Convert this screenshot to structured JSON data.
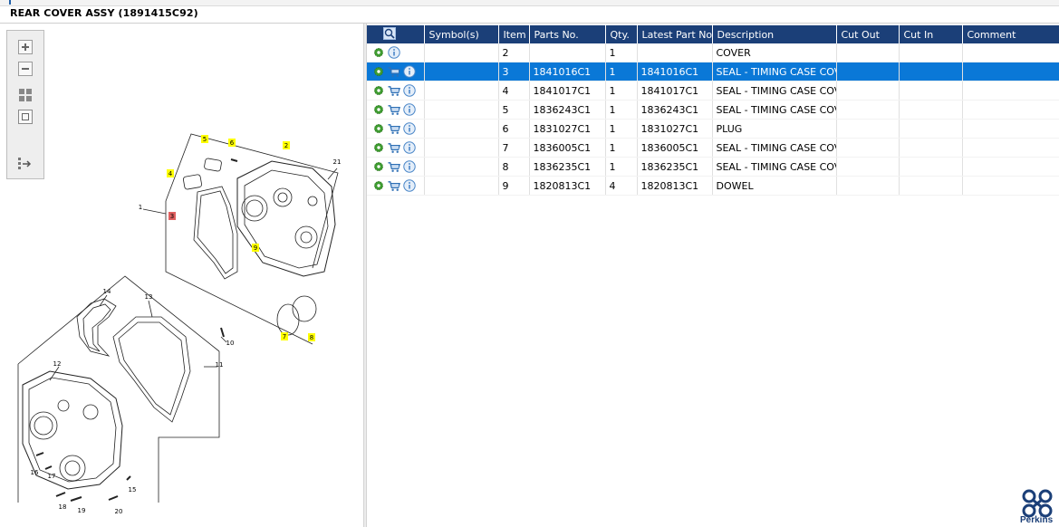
{
  "title": "REAR COVER ASSY (1891415C92)",
  "toolbar": {
    "buttons": [
      {
        "name": "zoom-in-button",
        "icon": "zoom-in-icon"
      },
      {
        "name": "zoom-out-button",
        "icon": "zoom-out-icon"
      },
      {
        "name": "fit-all-button",
        "icon": "fit-all-icon"
      },
      {
        "name": "fit-window-button",
        "icon": "fit-window-icon"
      },
      {
        "name": "export-button",
        "icon": "export-icon"
      }
    ]
  },
  "diagram": {
    "callouts": [
      "1",
      "2",
      "3",
      "4",
      "5",
      "6",
      "7",
      "8",
      "9",
      "10",
      "11",
      "12",
      "13",
      "14",
      "15",
      "16",
      "17",
      "18",
      "19",
      "20",
      "21"
    ],
    "highlighted": [
      "2",
      "4",
      "5",
      "6",
      "7",
      "8",
      "9"
    ],
    "selected": "3",
    "highlight_color": "#ffff00",
    "selected_color": "#e06060"
  },
  "table": {
    "header_icon": "search-icon",
    "columns": [
      "Symbol(s)",
      "Item",
      "Parts No.",
      "Qty.",
      "Latest Part No.",
      "Description",
      "Cut Out",
      "Cut In",
      "Comment"
    ],
    "rows": [
      {
        "icons": [
          "gear-icon",
          "info-icon"
        ],
        "symbol": "",
        "item": "2",
        "part_no": "",
        "qty": "1",
        "latest": "",
        "description": "COVER",
        "cut_out": "",
        "cut_in": "",
        "comment": ""
      },
      {
        "icons": [
          "gear-icon",
          "cart-icon",
          "info-icon"
        ],
        "symbol": "",
        "item": "3",
        "part_no": "1841016C1",
        "qty": "1",
        "latest": "1841016C1",
        "description": "SEAL - TIMING CASE COVE",
        "cut_out": "",
        "cut_in": "",
        "comment": "",
        "selected": true
      },
      {
        "icons": [
          "gear-icon",
          "cart-icon",
          "info-icon"
        ],
        "symbol": "",
        "item": "4",
        "part_no": "1841017C1",
        "qty": "1",
        "latest": "1841017C1",
        "description": "SEAL - TIMING CASE COVE",
        "cut_out": "",
        "cut_in": "",
        "comment": ""
      },
      {
        "icons": [
          "gear-icon",
          "cart-icon",
          "info-icon"
        ],
        "symbol": "",
        "item": "5",
        "part_no": "1836243C1",
        "qty": "1",
        "latest": "1836243C1",
        "description": "SEAL - TIMING CASE COVE",
        "cut_out": "",
        "cut_in": "",
        "comment": ""
      },
      {
        "icons": [
          "gear-icon",
          "cart-icon",
          "info-icon"
        ],
        "symbol": "",
        "item": "6",
        "part_no": "1831027C1",
        "qty": "1",
        "latest": "1831027C1",
        "description": "PLUG",
        "cut_out": "",
        "cut_in": "",
        "comment": ""
      },
      {
        "icons": [
          "gear-icon",
          "cart-icon",
          "info-icon"
        ],
        "symbol": "",
        "item": "7",
        "part_no": "1836005C1",
        "qty": "1",
        "latest": "1836005C1",
        "description": "SEAL - TIMING CASE COVE",
        "cut_out": "",
        "cut_in": "",
        "comment": ""
      },
      {
        "icons": [
          "gear-icon",
          "cart-icon",
          "info-icon"
        ],
        "symbol": "",
        "item": "8",
        "part_no": "1836235C1",
        "qty": "1",
        "latest": "1836235C1",
        "description": "SEAL - TIMING CASE COVE",
        "cut_out": "",
        "cut_in": "",
        "comment": ""
      },
      {
        "icons": [
          "gear-icon",
          "cart-icon",
          "info-icon"
        ],
        "symbol": "",
        "item": "9",
        "part_no": "1820813C1",
        "qty": "4",
        "latest": "1820813C1",
        "description": "DOWEL",
        "cut_out": "",
        "cut_in": "",
        "comment": ""
      }
    ]
  },
  "logo": {
    "text": "Perkins",
    "color": "#1b3f78"
  },
  "colors": {
    "header_bg": "#1b3f78",
    "selected_row": "#0a78d7",
    "gear": "#3d9b2f",
    "info": "#4a86c8",
    "cart": "#2d6fb5"
  }
}
